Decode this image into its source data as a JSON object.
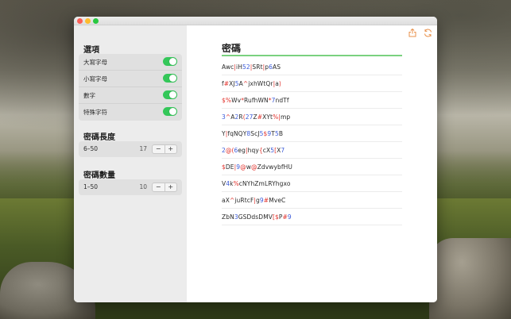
{
  "colors": {
    "toggle_on": "#34c759",
    "accent": "#e8914b",
    "title_underline": "#7ad17f",
    "symbol": "#e2322c",
    "digit": "#3b5bd9"
  },
  "sidebar": {
    "options_title": "選項",
    "options": [
      {
        "label": "大寫字母",
        "enabled": true
      },
      {
        "label": "小寫字母",
        "enabled": true
      },
      {
        "label": "數字",
        "enabled": true
      },
      {
        "label": "特殊字符",
        "enabled": true
      }
    ],
    "length_title": "密碼長度",
    "length": {
      "range": "6–50",
      "value": "17",
      "minus": "−",
      "plus": "+"
    },
    "count_title": "密碼數量",
    "count": {
      "range": "1–50",
      "value": "10",
      "minus": "−",
      "plus": "+"
    }
  },
  "main": {
    "title": "密碼",
    "share_icon": "share-icon",
    "refresh_icon": "refresh-icon",
    "passwords": [
      "Awc|iH52|SRt|p6AS",
      "f#XJ5A^jxhWtQr|a)",
      "$%Wv*RufhWN*7ndTf",
      "3^A2R(27Z#XYt%|mp",
      "Y|fqNQY8ScJ5$9T5B",
      "2@(6eg|hqy{cX5[X7",
      "$DE|9@w@ZdvwybfHU",
      "V4k%cNYhZmLRYhgxo",
      "aX^juRtcF|g9#MveC",
      "ZbN3GSDdsDMV[$P#9"
    ]
  }
}
